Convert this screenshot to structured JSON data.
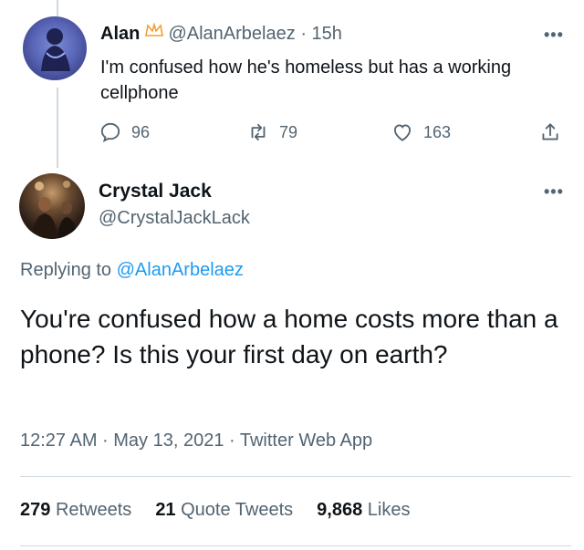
{
  "reply_tweet": {
    "name": "Alan",
    "badge_icon": "crown-icon",
    "handle": "@AlanArbelaez",
    "separator": "·",
    "time": "15h",
    "text": "I'm confused how he's homeless but has a working cellphone",
    "actions": {
      "replies": "96",
      "retweets": "79",
      "likes": "163"
    }
  },
  "main_tweet": {
    "name": "Crystal Jack",
    "handle": "@CrystalJackLack",
    "replying_prefix": "Replying to",
    "replying_to": "@AlanArbelaez",
    "text": "You're confused how a home costs more than a phone? Is this your first day on earth?",
    "meta": "12:27 AM · May 13, 2021 · Twitter Web App",
    "stats": {
      "retweets_count": "279",
      "retweets_label": "Retweets",
      "quotes_count": "21",
      "quotes_label": "Quote Tweets",
      "likes_count": "9,868",
      "likes_label": "Likes"
    }
  },
  "colors": {
    "text": "#0f1419",
    "secondary": "#536471",
    "link": "#1d9bf0",
    "badge": "#f0a030"
  }
}
